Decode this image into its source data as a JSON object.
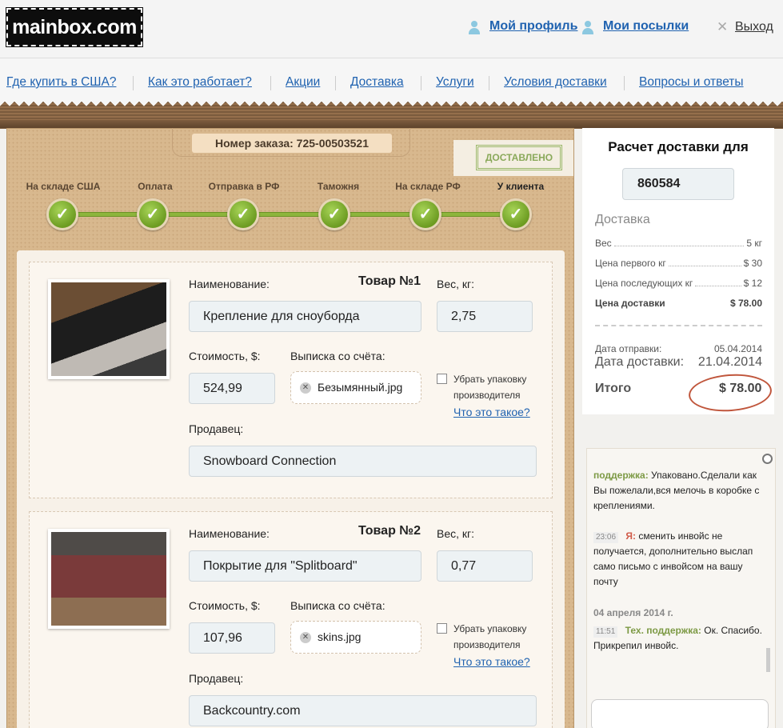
{
  "header": {
    "logo": "mainbox.com",
    "profile": "Мой профиль",
    "parcels": "Мои посылки",
    "logout": "Выход"
  },
  "nav": [
    "Где купить в США?",
    "Как это работает?",
    "Акции",
    "Доставка",
    "Услуги",
    "Условия доставки",
    "Вопросы и ответы"
  ],
  "order": {
    "number_label": "Номер заказа: 725-00503521",
    "stamp": "ДОСТАВЛЕНО",
    "progress": [
      {
        "label": "На складе США",
        "done": true
      },
      {
        "label": "Оплата",
        "done": true
      },
      {
        "label": "Отправка в РФ",
        "done": true
      },
      {
        "label": "Таможня",
        "done": true
      },
      {
        "label": "На складе РФ",
        "done": true
      },
      {
        "label": "У клиента",
        "done": true
      }
    ]
  },
  "labels": {
    "name": "Наименование:",
    "weight": "Вес, кг:",
    "cost": "Стоимость, $:",
    "invoice": "Выписка со счёта:",
    "remove_packaging": "Убрать упаковку производителя",
    "what_is_it": "Что это такое?",
    "seller": "Продавец:"
  },
  "items": [
    {
      "title": "Товар №1",
      "name": "Крепление для сноуборда",
      "weight": "2,75",
      "cost": "524,99",
      "file": "Безымянный.jpg",
      "seller": "Snowboard Connection",
      "remove_packaging": false
    },
    {
      "title": "Товар №2",
      "name": "Покрытие для \"Splitboard\"",
      "weight": "0,77",
      "cost": "107,96",
      "file": "skins.jpg",
      "seller": "Backcountry.com",
      "remove_packaging": false
    }
  ],
  "calc": {
    "title": "Расчет доставки для",
    "zip": "860584",
    "section": "Доставка",
    "rows": [
      {
        "label": "Вес",
        "value": "5 кг"
      },
      {
        "label": "Цена первого кг",
        "value": "$ 30"
      },
      {
        "label": "Цена последующих кг",
        "value": "$ 12"
      }
    ],
    "price_label": "Цена доставки",
    "price_value": "$ 78.00",
    "ship_date_label": "Дата отправки:",
    "ship_date": "05.04.2014",
    "delivery_date_label": "Дата доставки:",
    "delivery_date": "21.04.2014",
    "total_label": "Итого",
    "total_value": "$ 78.00"
  },
  "chat": {
    "m1_who": "поддержка:",
    "m1_text": "Упаковано.Сделали как Вы пожелали,вся мелочь в коробке с креплениями.",
    "m2_time": "23:06",
    "m2_who": "Я:",
    "m2_text": "сменить инвойс не получается, дополнительно выслап само письмо с инвойсом на вашу почту",
    "date": "04 апреля 2014 г.",
    "m3_time": "11:51",
    "m3_who": "Тех. поддержка:",
    "m3_text": "Ок. Спасибо. Прикрепил инвойс."
  },
  "colors": {
    "link": "#1f62b0",
    "progress_green": "#8db53c",
    "panel_brown": "#d8b88e",
    "support": "#7d9a45",
    "me": "#d05c4a"
  }
}
